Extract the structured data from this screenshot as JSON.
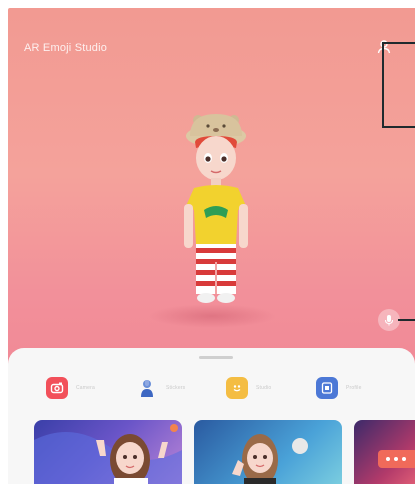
{
  "header": {
    "title": "AR Emoji Studio"
  },
  "tabs": [
    {
      "label": "Camera",
      "icon": "camera-icon",
      "color": "#f2505a"
    },
    {
      "label": "Stickers",
      "icon": "stickers-icon",
      "color": "#f4bd43"
    },
    {
      "label": "Studio",
      "icon": "studio-icon",
      "color": "#4c78d6"
    },
    {
      "label": "Profile",
      "icon": "profile-icon",
      "color": "#4c78d6"
    }
  ],
  "colors": {
    "background_top": "#f29a92",
    "background_bottom": "#ee7f90",
    "sheet": "#f7f7f7",
    "annotation": "#1f2a2e"
  }
}
